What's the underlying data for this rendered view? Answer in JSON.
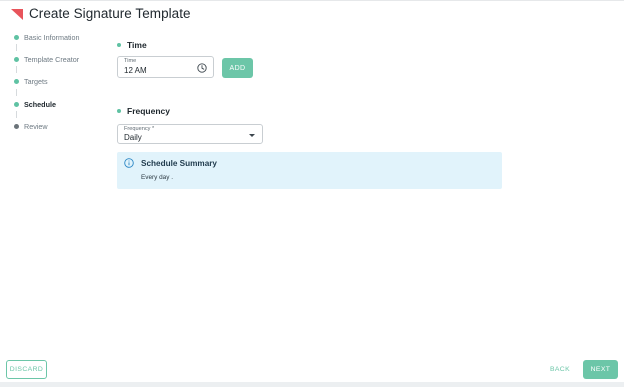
{
  "header": {
    "title": "Create Signature Template",
    "logo_icon": "brand-logo-icon",
    "brand_color": "#e8545b"
  },
  "steps": [
    {
      "label": "Basic Information",
      "status": "completed"
    },
    {
      "label": "Template Creator",
      "status": "completed"
    },
    {
      "label": "Targets",
      "status": "completed"
    },
    {
      "label": "Schedule",
      "status": "active"
    },
    {
      "label": "Review",
      "status": "pending"
    }
  ],
  "time_section": {
    "heading": "Time",
    "field_label": "Time",
    "field_value": "12 AM",
    "icon": "clock-icon",
    "add_label": "ADD"
  },
  "frequency_section": {
    "heading": "Frequency",
    "field_label": "Frequency *",
    "selected_value": "Daily",
    "icon": "chevron-down-icon"
  },
  "summary": {
    "title": "Schedule Summary",
    "text": "Every day .",
    "icon": "info-icon",
    "background": "#e1f3fb"
  },
  "footer": {
    "discard_label": "DISCARD",
    "back_label": "BACK",
    "next_label": "NEXT"
  },
  "colors": {
    "accent": "#6cc6a8",
    "completed_step": "#5fc2a3",
    "pending_step": "#6b7379"
  }
}
